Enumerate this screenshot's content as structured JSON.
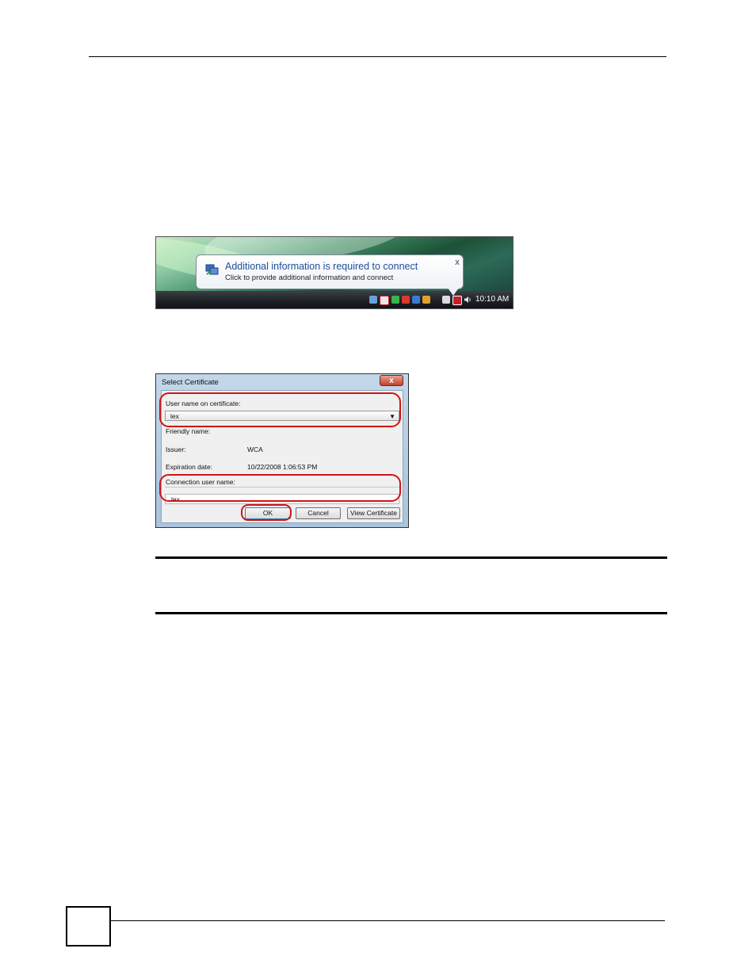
{
  "balloon": {
    "title": "Additional information is required to connect",
    "subtitle": "Click to provide additional information and connect",
    "close": "x"
  },
  "taskbar": {
    "clock": "10:10 AM"
  },
  "dialog": {
    "title": "Select Certificate",
    "close": "x",
    "user_name_label": "User name on certificate:",
    "user_name_value": "lex",
    "friendly_name_label": "Friendly name:",
    "issuer_label": "Issuer:",
    "issuer_value": "WCA",
    "expiration_label": "Expiration date:",
    "expiration_value": "10/22/2008 1:06:53 PM",
    "connection_label": "Connection user name:",
    "connection_value": "lex",
    "ok": "OK",
    "cancel": "Cancel",
    "view_certificate": "View Certificate"
  },
  "colors": {
    "highlight": "#d01414",
    "balloon_title": "#1f4e9a"
  }
}
